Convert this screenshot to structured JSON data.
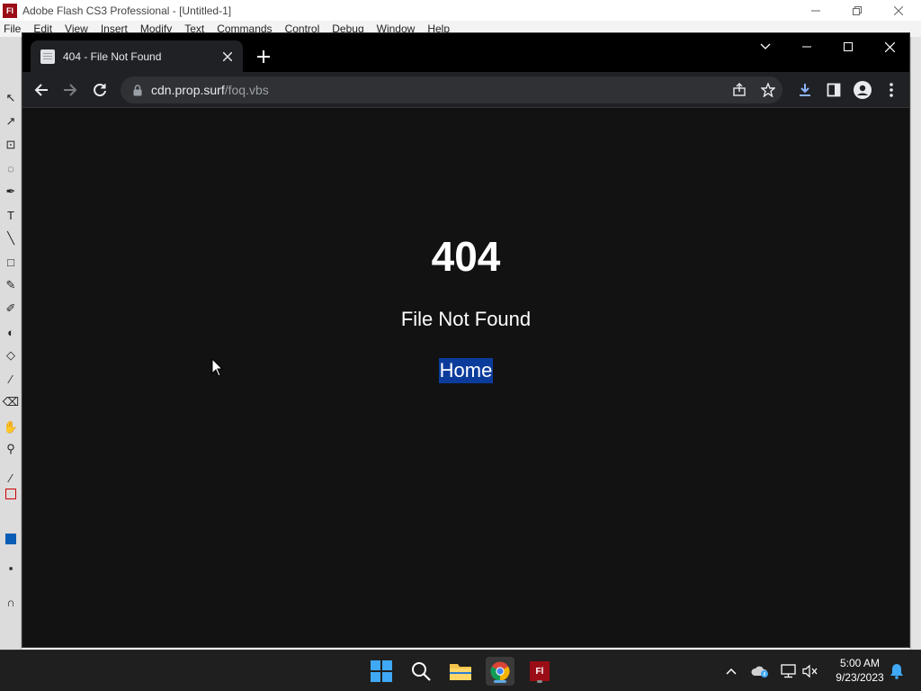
{
  "flash": {
    "logo": "Fl",
    "title": "Adobe Flash CS3 Professional - [Untitled-1]",
    "menu": [
      "File",
      "Edit",
      "View",
      "Insert",
      "Modify",
      "Text",
      "Commands",
      "Control",
      "Debug",
      "Window",
      "Help"
    ]
  },
  "browser": {
    "tab_title": "404 - File Not Found",
    "url_host": "cdn.prop.surf",
    "url_path": "/foq.vbs"
  },
  "page": {
    "error_code": "404",
    "error_message": "File Not Found",
    "home_link": "Home",
    "background_color": "#121212",
    "link_highlight_color": "#0b3c9c"
  },
  "taskbar": {
    "flash_label": "Fl",
    "time": "5:00 AM",
    "date": "9/23/2023"
  }
}
